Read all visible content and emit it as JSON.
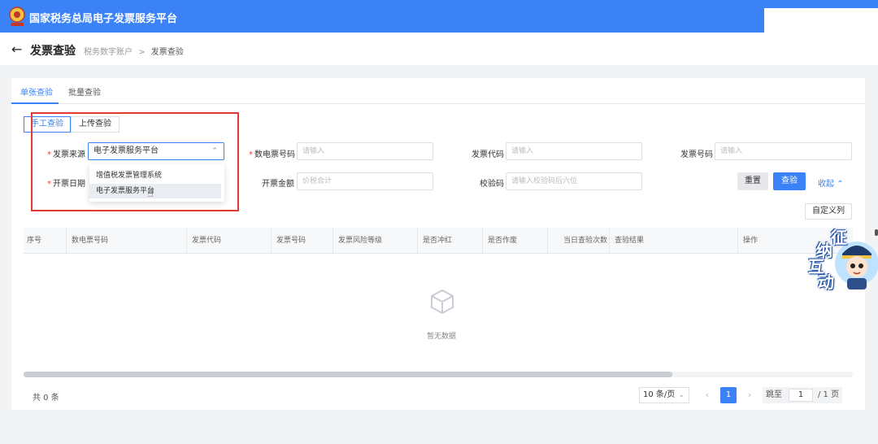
{
  "header": {
    "app_title": "国家税务总局电子发票服务平台",
    "logo_caption": "税务"
  },
  "subheader": {
    "back_icon": "arrow-left-icon",
    "page_title": "发票查验",
    "breadcrumb_parent": "税务数字账户",
    "breadcrumb_sep": ">",
    "breadcrumb_current": "发票查验"
  },
  "tabs": [
    {
      "label": "单张查验",
      "active": true
    },
    {
      "label": "批量查验",
      "active": false
    }
  ],
  "mode_toggle": [
    {
      "label": "手工查验",
      "active": true
    },
    {
      "label": "上传查验",
      "active": false
    }
  ],
  "form": {
    "source_label": "发票来源",
    "source_value": "电子发票服务平台",
    "digital_no_label": "数电票号码",
    "digital_no_placeholder": "请输入",
    "invoice_code_label": "发票代码",
    "invoice_code_placeholder": "请输入",
    "invoice_no_label": "发票号码",
    "invoice_no_placeholder": "请输入",
    "issue_date_label": "开票日期",
    "amount_label": "开票金额",
    "amount_placeholder": "价税合计",
    "check_code_label": "校验码",
    "check_code_placeholder": "请输入校验码后六位"
  },
  "dropdown_options": [
    "增值税发票管理系统",
    "电子发票服务平台"
  ],
  "buttons": {
    "reset": "重置",
    "query": "查验",
    "collapse": "收起",
    "custom_columns": "自定义列"
  },
  "table": {
    "columns": [
      "序号",
      "数电票号码",
      "发票代码",
      "发票号码",
      "发票风险等级",
      "是否冲红",
      "是否作废",
      "当日查验次数",
      "查验结果",
      "操作"
    ],
    "empty_text": "暂无数据"
  },
  "pagination": {
    "total_text": "共 0 条",
    "page_size": "10 条/页",
    "prev": "‹",
    "next": "›",
    "current_page": "1",
    "jump_label": "跳至",
    "jump_value": "1",
    "total_pages": "/ 1 页"
  },
  "mascot": {
    "chars": [
      "征",
      "纳",
      "互",
      "动"
    ]
  },
  "colors": {
    "primary": "#3b82f6",
    "highlight_box": "#e53935"
  }
}
